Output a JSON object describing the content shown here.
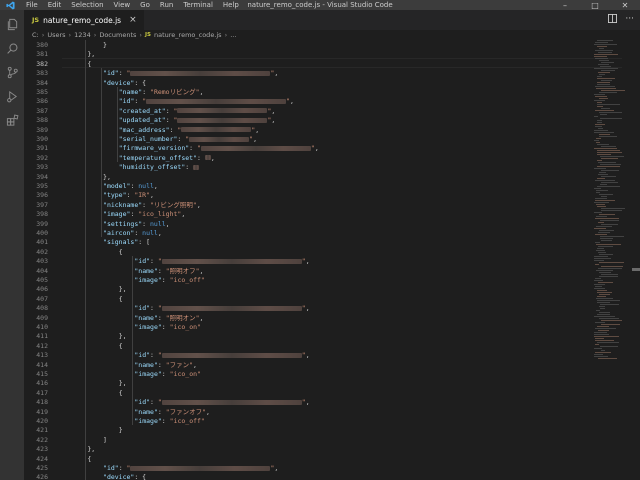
{
  "titlebar": {
    "menu": [
      "File",
      "Edit",
      "Selection",
      "View",
      "Go",
      "Run",
      "Terminal",
      "Help"
    ],
    "title": "nature_remo_code.js - Visual Studio Code"
  },
  "activity": [
    "explorer-icon",
    "search-icon",
    "source-control-icon",
    "run-debug-icon",
    "extensions-icon"
  ],
  "tab": {
    "badge": "JS",
    "label": "nature_remo_code.js",
    "close": "×"
  },
  "breadcrumb": {
    "parts": [
      "C:",
      "Users",
      "1234",
      "Documents"
    ],
    "file_badge": "JS",
    "file": "nature_remo_code.js",
    "tail": "..."
  },
  "editor": {
    "current_line": 382,
    "lines": [
      {
        "n": 380,
        "indent": 6,
        "parts": [
          [
            "p",
            "}"
          ]
        ]
      },
      {
        "n": 381,
        "indent": 4,
        "parts": [
          [
            "p",
            "},"
          ]
        ]
      },
      {
        "n": 382,
        "indent": 4,
        "parts": [
          [
            "p",
            "{"
          ]
        ]
      },
      {
        "n": 383,
        "indent": 6,
        "parts": [
          [
            "k",
            "\"id\""
          ],
          [
            "p",
            ": "
          ],
          [
            "s",
            "\""
          ],
          [
            "blur",
            140
          ],
          [
            "s",
            "\""
          ],
          [
            "p",
            ","
          ]
        ]
      },
      {
        "n": 384,
        "indent": 6,
        "parts": [
          [
            "k",
            "\"device\""
          ],
          [
            "p",
            ": {"
          ]
        ]
      },
      {
        "n": 385,
        "indent": 8,
        "parts": [
          [
            "k",
            "\"name\""
          ],
          [
            "p",
            ": "
          ],
          [
            "s",
            "\"Remoリビング\""
          ],
          [
            "p",
            ","
          ]
        ]
      },
      {
        "n": 386,
        "indent": 8,
        "parts": [
          [
            "k",
            "\"id\""
          ],
          [
            "p",
            ": "
          ],
          [
            "s",
            "\""
          ],
          [
            "blur",
            140
          ],
          [
            "s",
            "\""
          ],
          [
            "p",
            ","
          ]
        ]
      },
      {
        "n": 387,
        "indent": 8,
        "parts": [
          [
            "k",
            "\"created_at\""
          ],
          [
            "p",
            ": "
          ],
          [
            "s",
            "\""
          ],
          [
            "blur",
            90
          ],
          [
            "s",
            "\""
          ],
          [
            "p",
            ","
          ]
        ]
      },
      {
        "n": 388,
        "indent": 8,
        "parts": [
          [
            "k",
            "\"updated_at\""
          ],
          [
            "p",
            ": "
          ],
          [
            "s",
            "\""
          ],
          [
            "blur",
            90
          ],
          [
            "s",
            "\""
          ],
          [
            "p",
            ","
          ]
        ]
      },
      {
        "n": 389,
        "indent": 8,
        "parts": [
          [
            "k",
            "\"mac_address\""
          ],
          [
            "p",
            ": "
          ],
          [
            "s",
            "\""
          ],
          [
            "blur",
            70
          ],
          [
            "s",
            "\""
          ],
          [
            "p",
            ","
          ]
        ]
      },
      {
        "n": 390,
        "indent": 8,
        "parts": [
          [
            "k",
            "\"serial_number\""
          ],
          [
            "p",
            ": "
          ],
          [
            "s",
            "\""
          ],
          [
            "blur",
            60
          ],
          [
            "s",
            "\""
          ],
          [
            "p",
            ","
          ]
        ]
      },
      {
        "n": 391,
        "indent": 8,
        "parts": [
          [
            "k",
            "\"firmware_version\""
          ],
          [
            "p",
            ": "
          ],
          [
            "s",
            "\""
          ],
          [
            "blur",
            110
          ],
          [
            "s",
            "\""
          ],
          [
            "p",
            ","
          ]
        ]
      },
      {
        "n": 392,
        "indent": 8,
        "parts": [
          [
            "k",
            "\"temperature_offset\""
          ],
          [
            "p",
            ": "
          ],
          [
            "blur",
            6
          ],
          [
            "p",
            ","
          ]
        ]
      },
      {
        "n": 393,
        "indent": 8,
        "parts": [
          [
            "k",
            "\"humidity_offset\""
          ],
          [
            "p",
            ": "
          ],
          [
            "blur",
            6
          ]
        ]
      },
      {
        "n": 394,
        "indent": 6,
        "parts": [
          [
            "p",
            "},"
          ]
        ]
      },
      {
        "n": 395,
        "indent": 6,
        "parts": [
          [
            "k",
            "\"model\""
          ],
          [
            "p",
            ": "
          ],
          [
            "kw",
            "null"
          ],
          [
            "p",
            ","
          ]
        ]
      },
      {
        "n": 396,
        "indent": 6,
        "parts": [
          [
            "k",
            "\"type\""
          ],
          [
            "p",
            ": "
          ],
          [
            "s",
            "\"IR\""
          ],
          [
            "p",
            ","
          ]
        ]
      },
      {
        "n": 397,
        "indent": 6,
        "parts": [
          [
            "k",
            "\"nickname\""
          ],
          [
            "p",
            ": "
          ],
          [
            "s",
            "\"リビング照明\""
          ],
          [
            "p",
            ","
          ]
        ]
      },
      {
        "n": 398,
        "indent": 6,
        "parts": [
          [
            "k",
            "\"image\""
          ],
          [
            "p",
            ": "
          ],
          [
            "s",
            "\"ico_light\""
          ],
          [
            "p",
            ","
          ]
        ]
      },
      {
        "n": 399,
        "indent": 6,
        "parts": [
          [
            "k",
            "\"settings\""
          ],
          [
            "p",
            ": "
          ],
          [
            "kw",
            "null"
          ],
          [
            "p",
            ","
          ]
        ]
      },
      {
        "n": 400,
        "indent": 6,
        "parts": [
          [
            "k",
            "\"aircon\""
          ],
          [
            "p",
            ": "
          ],
          [
            "kw",
            "null"
          ],
          [
            "p",
            ","
          ]
        ]
      },
      {
        "n": 401,
        "indent": 6,
        "parts": [
          [
            "k",
            "\"signals\""
          ],
          [
            "p",
            ": ["
          ]
        ]
      },
      {
        "n": 402,
        "indent": 8,
        "parts": [
          [
            "p",
            "{"
          ]
        ]
      },
      {
        "n": 403,
        "indent": 10,
        "parts": [
          [
            "k",
            "\"id\""
          ],
          [
            "p",
            ": "
          ],
          [
            "s",
            "\""
          ],
          [
            "blur",
            140
          ],
          [
            "s",
            "\""
          ],
          [
            "p",
            ","
          ]
        ]
      },
      {
        "n": 404,
        "indent": 10,
        "parts": [
          [
            "k",
            "\"name\""
          ],
          [
            "p",
            ": "
          ],
          [
            "s",
            "\"照明オフ\""
          ],
          [
            "p",
            ","
          ]
        ]
      },
      {
        "n": 405,
        "indent": 10,
        "parts": [
          [
            "k",
            "\"image\""
          ],
          [
            "p",
            ": "
          ],
          [
            "s",
            "\"ico_off\""
          ]
        ]
      },
      {
        "n": 406,
        "indent": 8,
        "parts": [
          [
            "p",
            "},"
          ]
        ]
      },
      {
        "n": 407,
        "indent": 8,
        "parts": [
          [
            "p",
            "{"
          ]
        ]
      },
      {
        "n": 408,
        "indent": 10,
        "parts": [
          [
            "k",
            "\"id\""
          ],
          [
            "p",
            ": "
          ],
          [
            "s",
            "\""
          ],
          [
            "blur",
            140
          ],
          [
            "s",
            "\""
          ],
          [
            "p",
            ","
          ]
        ]
      },
      {
        "n": 409,
        "indent": 10,
        "parts": [
          [
            "k",
            "\"name\""
          ],
          [
            "p",
            ": "
          ],
          [
            "s",
            "\"照明オン\""
          ],
          [
            "p",
            ","
          ]
        ]
      },
      {
        "n": 410,
        "indent": 10,
        "parts": [
          [
            "k",
            "\"image\""
          ],
          [
            "p",
            ": "
          ],
          [
            "s",
            "\"ico_on\""
          ]
        ]
      },
      {
        "n": 411,
        "indent": 8,
        "parts": [
          [
            "p",
            "},"
          ]
        ]
      },
      {
        "n": 412,
        "indent": 8,
        "parts": [
          [
            "p",
            "{"
          ]
        ]
      },
      {
        "n": 413,
        "indent": 10,
        "parts": [
          [
            "k",
            "\"id\""
          ],
          [
            "p",
            ": "
          ],
          [
            "s",
            "\""
          ],
          [
            "blur",
            140
          ],
          [
            "s",
            "\""
          ],
          [
            "p",
            ","
          ]
        ]
      },
      {
        "n": 414,
        "indent": 10,
        "parts": [
          [
            "k",
            "\"name\""
          ],
          [
            "p",
            ": "
          ],
          [
            "s",
            "\"ファン\""
          ],
          [
            "p",
            ","
          ]
        ]
      },
      {
        "n": 415,
        "indent": 10,
        "parts": [
          [
            "k",
            "\"image\""
          ],
          [
            "p",
            ": "
          ],
          [
            "s",
            "\"ico_on\""
          ]
        ]
      },
      {
        "n": 416,
        "indent": 8,
        "parts": [
          [
            "p",
            "},"
          ]
        ]
      },
      {
        "n": 417,
        "indent": 8,
        "parts": [
          [
            "p",
            "{"
          ]
        ]
      },
      {
        "n": 418,
        "indent": 10,
        "parts": [
          [
            "k",
            "\"id\""
          ],
          [
            "p",
            ": "
          ],
          [
            "s",
            "\""
          ],
          [
            "blur",
            140
          ],
          [
            "s",
            "\""
          ],
          [
            "p",
            ","
          ]
        ]
      },
      {
        "n": 419,
        "indent": 10,
        "parts": [
          [
            "k",
            "\"name\""
          ],
          [
            "p",
            ": "
          ],
          [
            "s",
            "\"ファンオフ\""
          ],
          [
            "p",
            ","
          ]
        ]
      },
      {
        "n": 420,
        "indent": 10,
        "parts": [
          [
            "k",
            "\"image\""
          ],
          [
            "p",
            ": "
          ],
          [
            "s",
            "\"ico_off\""
          ]
        ]
      },
      {
        "n": 421,
        "indent": 8,
        "parts": [
          [
            "p",
            "}"
          ]
        ]
      },
      {
        "n": 422,
        "indent": 6,
        "parts": [
          [
            "p",
            "]"
          ]
        ]
      },
      {
        "n": 423,
        "indent": 4,
        "parts": [
          [
            "p",
            "},"
          ]
        ]
      },
      {
        "n": 424,
        "indent": 4,
        "parts": [
          [
            "p",
            "{"
          ]
        ]
      },
      {
        "n": 425,
        "indent": 6,
        "parts": [
          [
            "k",
            "\"id\""
          ],
          [
            "p",
            ": "
          ],
          [
            "s",
            "\""
          ],
          [
            "blur",
            140
          ],
          [
            "s",
            "\""
          ],
          [
            "p",
            ","
          ]
        ]
      },
      {
        "n": 426,
        "indent": 6,
        "parts": [
          [
            "k",
            "\"device\""
          ],
          [
            "p",
            ": {"
          ]
        ]
      }
    ]
  }
}
